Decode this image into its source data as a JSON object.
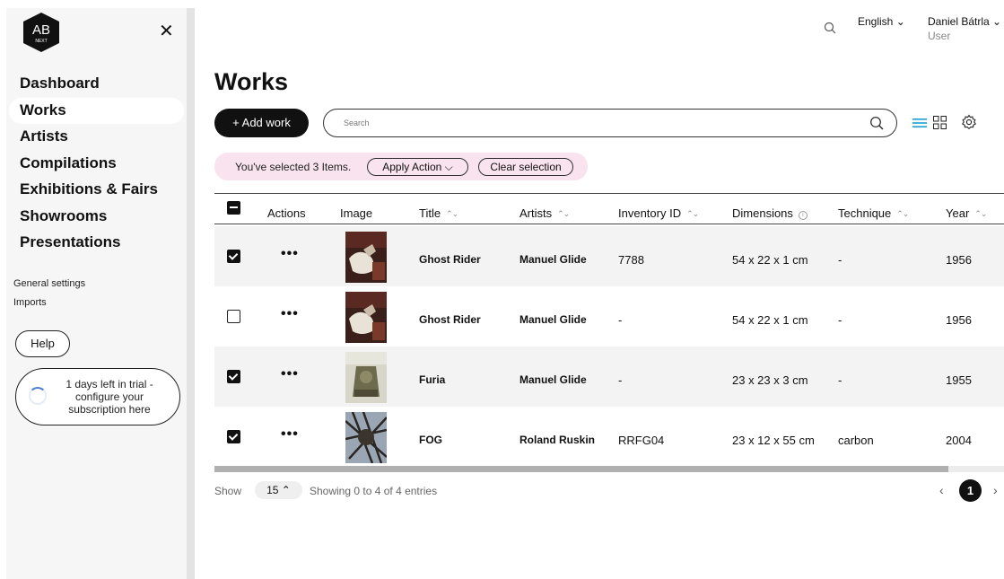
{
  "sidebar": {
    "logo_text": "AB",
    "logo_sub": "NEXT",
    "close_symbol": "✕",
    "nav": [
      {
        "label": "Dashboard",
        "active": false
      },
      {
        "label": "Works",
        "active": true
      },
      {
        "label": "Artists",
        "active": false
      },
      {
        "label": "Compilations",
        "active": false
      },
      {
        "label": "Exhibitions & Fairs",
        "active": false
      },
      {
        "label": "Showrooms",
        "active": false
      },
      {
        "label": "Presentations",
        "active": false
      }
    ],
    "secondary": [
      "General settings",
      "Imports"
    ],
    "help_label": "Help",
    "trial_text": "1 days left in trial - configure your subscription here"
  },
  "header": {
    "language": "English",
    "user_name": "Daniel Bátrla",
    "user_role": "User"
  },
  "page": {
    "title": "Works",
    "add_label": "+ Add work",
    "search_placeholder": "Search"
  },
  "selection": {
    "text": "You've selected 3 Items.",
    "apply_label": "Apply Action ⌵",
    "clear_label": "Clear selection"
  },
  "table": {
    "columns": [
      "Actions",
      "Image",
      "Title",
      "Artists",
      "Inventory ID",
      "Dimensions",
      "Technique",
      "Year"
    ],
    "rows": [
      {
        "checked": true,
        "title": "Ghost Rider",
        "artist": "Manuel Glide",
        "inventory_id": "7788",
        "dimensions": "54 x 22 x 1 cm",
        "technique": "-",
        "year": "1956"
      },
      {
        "checked": false,
        "title": "Ghost Rider",
        "artist": "Manuel Glide",
        "inventory_id": "-",
        "dimensions": "54 x 22 x 1 cm",
        "technique": "-",
        "year": "1956"
      },
      {
        "checked": true,
        "title": "Furia",
        "artist": "Manuel Glide",
        "inventory_id": "-",
        "dimensions": "23 x 23 x 3 cm",
        "technique": "-",
        "year": "1955"
      },
      {
        "checked": true,
        "title": "FOG",
        "artist": "Roland Ruskin",
        "inventory_id": "RRFG04",
        "dimensions": "23 x 12 x 55 cm",
        "technique": "carbon",
        "year": "2004"
      }
    ],
    "actions_symbol": "•••"
  },
  "footer": {
    "show_label": "Show",
    "page_size": "15 ⌃",
    "showing_text": "Showing 0 to 4 of 4 entries",
    "current_page": "1",
    "prev_symbol": "‹",
    "next_symbol": "›"
  },
  "colors": {
    "accent": "#1a9fd8",
    "selection_bg": "#f8e3ee"
  }
}
